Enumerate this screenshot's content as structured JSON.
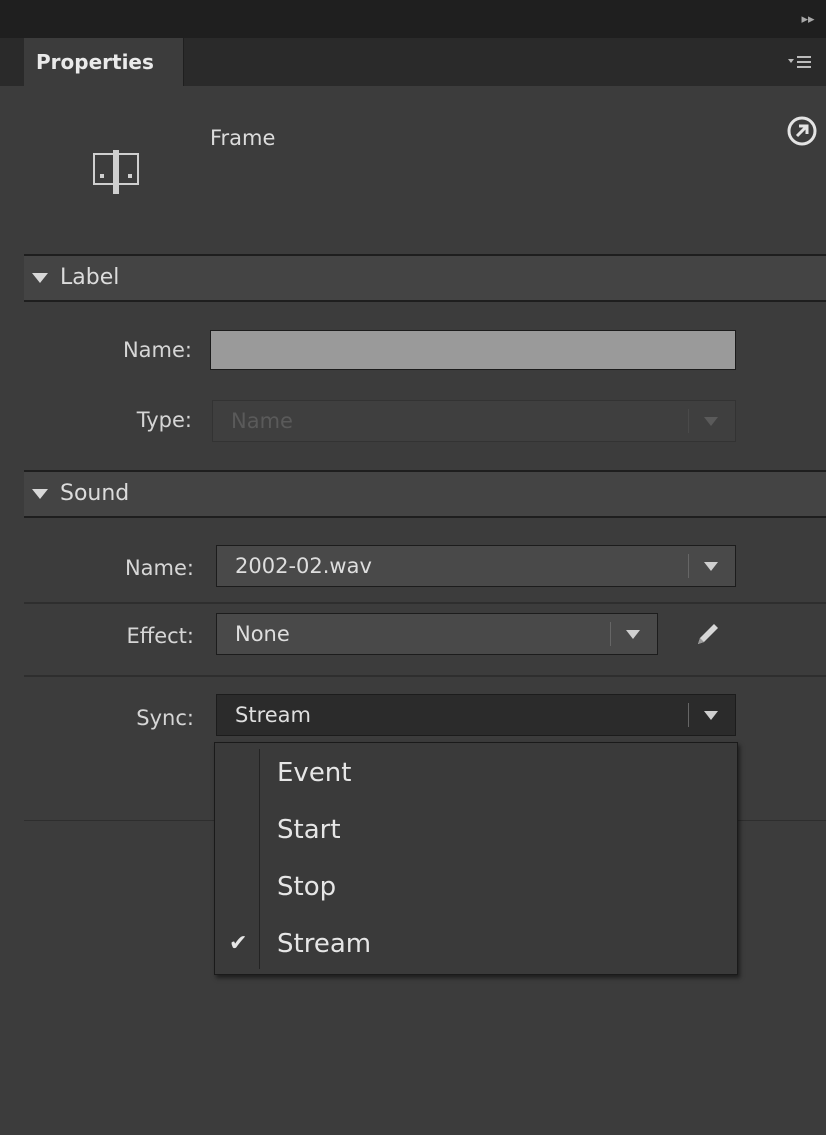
{
  "panel": {
    "tab_label": "Properties",
    "frame_title": "Frame"
  },
  "label_section": {
    "header": "Label",
    "name_label": "Name:",
    "name_value": "",
    "type_label": "Type:",
    "type_value": "Name"
  },
  "sound_section": {
    "header": "Sound",
    "name_label": "Name:",
    "name_value": "2002-02.wav",
    "effect_label": "Effect:",
    "effect_value": "None",
    "sync_label": "Sync:",
    "sync_value": "Stream"
  },
  "sync_dropdown": {
    "options": [
      {
        "label": "Event",
        "checked": false
      },
      {
        "label": "Start",
        "checked": false
      },
      {
        "label": "Stop",
        "checked": false
      },
      {
        "label": "Stream",
        "checked": true
      }
    ]
  },
  "icons": {
    "collapse": "double-chevron-right-icon",
    "panel_menu": "panel-menu-icon",
    "frame": "frame-icon",
    "help": "help-arrow-icon",
    "edit_envelope": "pencil-icon",
    "checkmark": "checkmark-icon"
  },
  "colors": {
    "panel_bg": "#3c3c3c",
    "topbar_bg": "#1f1f1f",
    "section_bg": "#444444",
    "name_input_bg": "#9a9a9a",
    "text": "#d6d6d6"
  }
}
